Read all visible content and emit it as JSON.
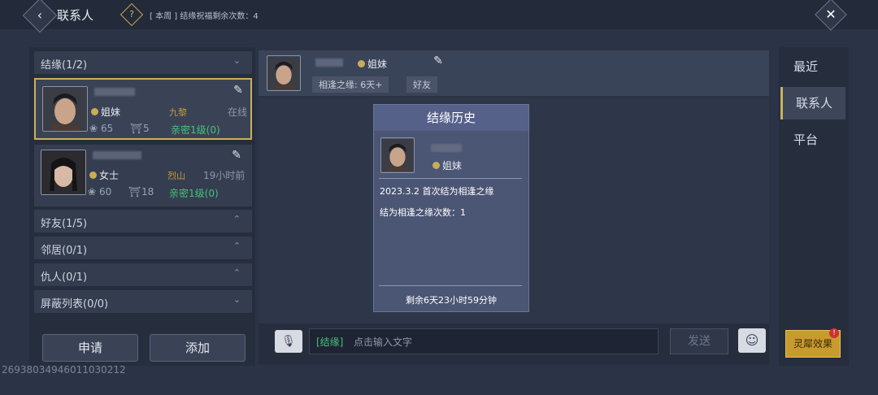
{
  "header": {
    "title": "联系人",
    "notice": "[ 本周 ] 结缘祝福剩余次数：4",
    "help": "?",
    "back": "‹",
    "close": "✕"
  },
  "sidebar": {
    "categories": [
      {
        "label": "结缘(1/2)",
        "chevron": "⌄"
      },
      {
        "label": "好友(1/5)",
        "chevron": "⌃"
      },
      {
        "label": "邻居(0/1)",
        "chevron": "⌃"
      },
      {
        "label": "仇人(0/1)",
        "chevron": "⌃"
      },
      {
        "label": "屏蔽列表(0/0)",
        "chevron": "⌄"
      }
    ],
    "contacts": [
      {
        "relation": "姐妹",
        "server": "九黎",
        "status": "在线",
        "stat1": "65",
        "stat2": "5",
        "intimacy": "亲密1级(0)"
      },
      {
        "relation": "女士",
        "server": "烈山",
        "status": "19小时前",
        "stat1": "60",
        "stat2": "18",
        "intimacy": "亲密1级(0)"
      }
    ],
    "apply_label": "申请",
    "add_label": "添加",
    "uid": "2693803494601103021​2"
  },
  "conversation": {
    "relation": "姐妹",
    "bond_tag": "相逢之缘: 6天+",
    "friend_tag": "好友"
  },
  "history": {
    "title": "结缘历史",
    "relation": "姐妹",
    "event": "2023.3.2  首次结为相逢之缘",
    "count": "结为相逢之缘次数：1",
    "remaining": "剩余6天23小时59分钟"
  },
  "chat": {
    "channel": "[结缘]",
    "placeholder": "点击输入文字",
    "send_label": "发送"
  },
  "tabs": [
    "最近",
    "联系人",
    "平台"
  ],
  "effect": {
    "label": "灵犀效果",
    "badge": "!"
  },
  "colors": {
    "accent": "#c9b15a",
    "intimacy": "#48c27a",
    "server": "#c69a3a"
  }
}
